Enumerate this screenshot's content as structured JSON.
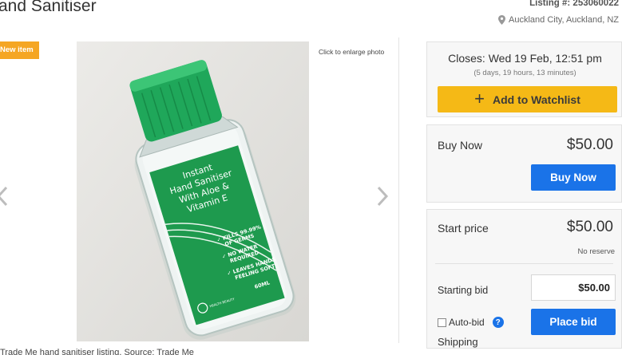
{
  "header": {
    "title": "and Sanitiser",
    "listing": "Listing #: 253060022",
    "location": "Auckland City, Auckland, NZ"
  },
  "photo": {
    "badge": "New item",
    "enlarge_label": "Click to enlarge photo",
    "product_label": {
      "line1": "Instant",
      "line2": "Hand Sanitiser",
      "line3": "With Aloe &",
      "line4": "Vitamin E",
      "claim1a": "✓ KILLS 99.99%",
      "claim1b": "OF GERMS",
      "claim2a": "✓ NO WATER",
      "claim2b": "REQUIRED",
      "claim3a": "✓ LEAVES HANDS",
      "claim3b": "FEELING SOFT",
      "volume": "60ML",
      "brand": "HEALTH BEAUTY"
    }
  },
  "auction": {
    "closes": "Closes: Wed 19 Feb, 12:51 pm",
    "remaining": "(5 days, 19 hours, 13 minutes)",
    "watchlist_label": "Add to Watchlist",
    "buy_now_label": "Buy Now",
    "buy_now_price": "$50.00",
    "buy_now_button": "Buy Now",
    "start_price_label": "Start price",
    "start_price": "$50.00",
    "reserve": "No reserve",
    "starting_bid_label": "Starting bid",
    "starting_bid_value": "$50.00",
    "autobid_label": "Auto-bid",
    "help_glyph": "?",
    "place_bid_button": "Place bid",
    "shipping_label": "Shipping"
  },
  "caption": "Trade Me hand sanitiser listing. Source: Trade Me",
  "colors": {
    "accent_blue": "#1a73e8",
    "watchlist_yellow": "#f5b916",
    "badge_orange": "#f5a623",
    "bottle_green": "#1e9a4e"
  }
}
